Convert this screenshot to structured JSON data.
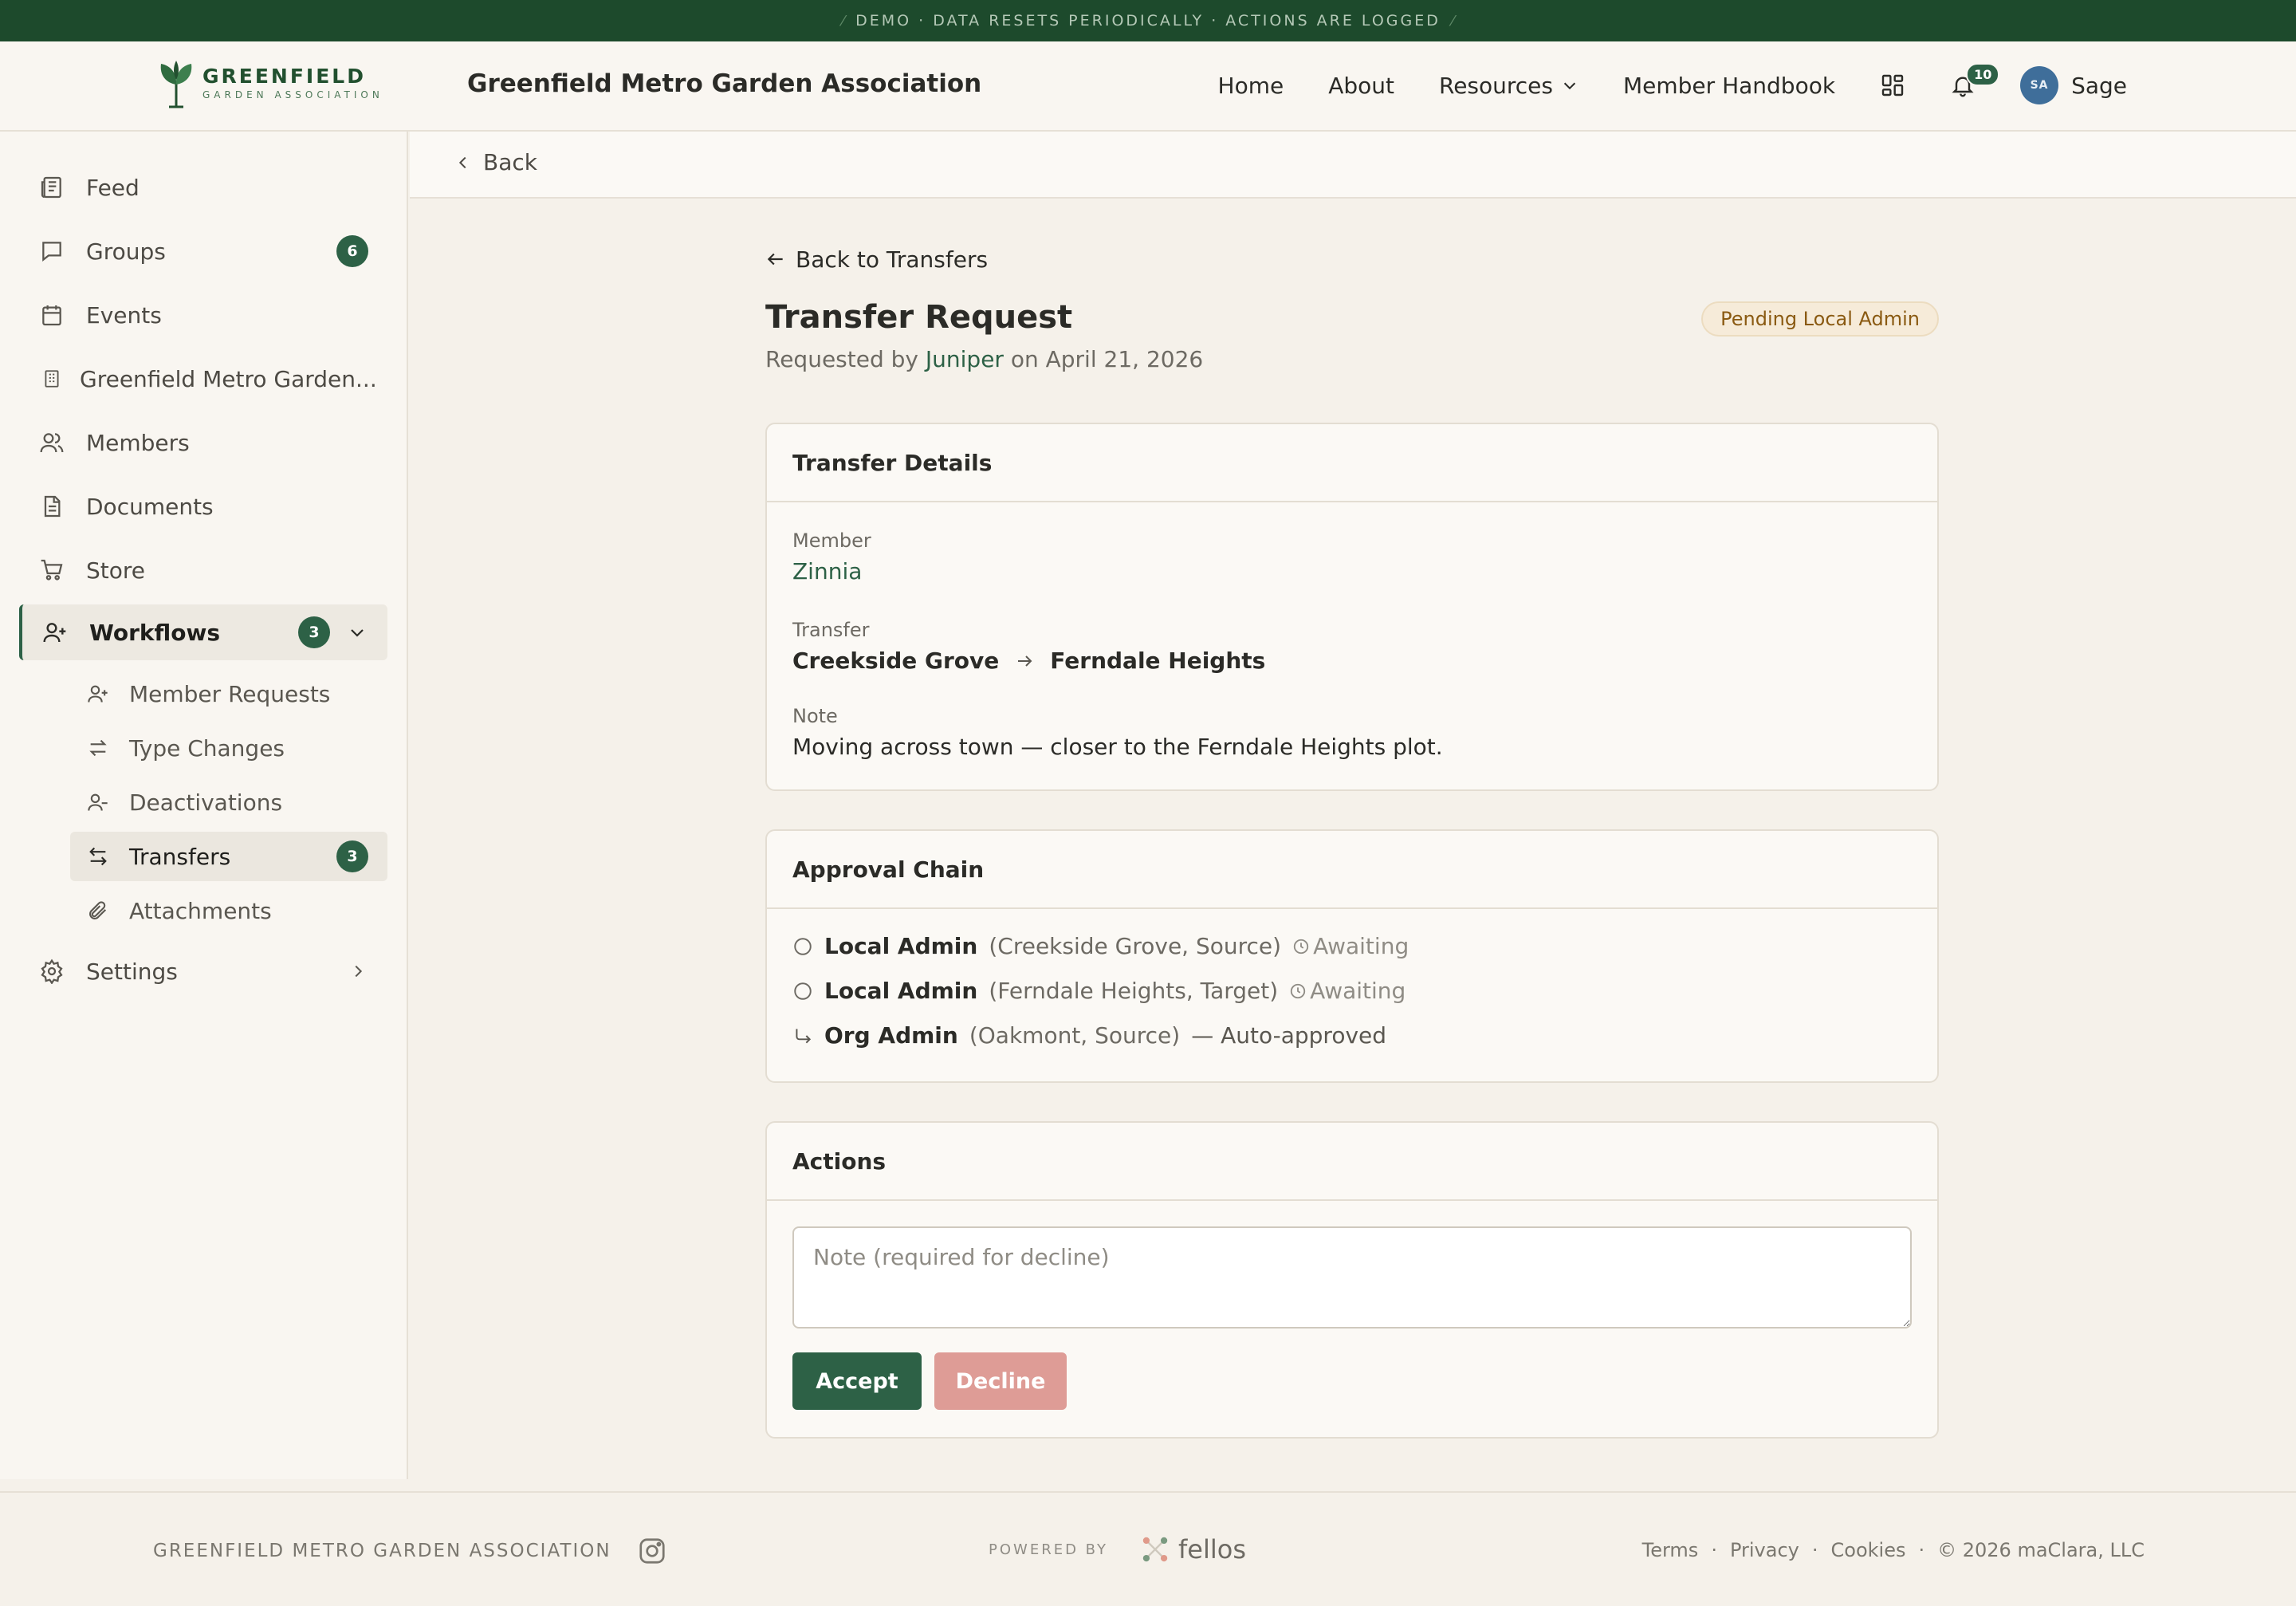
{
  "banner": {
    "text": "DEMO · DATA RESETS PERIODICALLY · ACTIONS ARE LOGGED"
  },
  "brand": {
    "name": "GREENFIELD",
    "sub": "GARDEN ASSOCIATION",
    "color": "#22502f"
  },
  "header": {
    "org_title": "Greenfield Metro Garden Association",
    "nav": {
      "home": "Home",
      "about": "About",
      "resources": "Resources",
      "handbook": "Member Handbook"
    },
    "notifications_count": "10",
    "user": {
      "initials": "SA",
      "name": "Sage"
    }
  },
  "sidebar": {
    "feed": "Feed",
    "groups": {
      "label": "Groups",
      "count": "6"
    },
    "events": "Events",
    "org": "Greenfield Metro Garden...",
    "members": "Members",
    "documents": "Documents",
    "store": "Store",
    "workflows": {
      "label": "Workflows",
      "count": "3"
    },
    "sub": {
      "member_requests": "Member Requests",
      "type_changes": "Type Changes",
      "deactivations": "Deactivations",
      "transfers": {
        "label": "Transfers",
        "count": "3"
      },
      "attachments": "Attachments"
    },
    "settings": "Settings"
  },
  "backbar": {
    "label": "Back"
  },
  "page": {
    "back_link": "Back to Transfers",
    "title": "Transfer Request",
    "status": "Pending Local Admin",
    "requested_prefix": "Requested by",
    "requester": "Juniper",
    "requested_on": "on April 21, 2026"
  },
  "details": {
    "heading": "Transfer Details",
    "member_label": "Member",
    "member": "Zinnia",
    "transfer_label": "Transfer",
    "from": "Creekside Grove",
    "to": "Ferndale Heights",
    "note_label": "Note",
    "note": "Moving across town — closer to the Ferndale Heights plot."
  },
  "approval": {
    "heading": "Approval Chain",
    "steps": [
      {
        "role": "Local Admin",
        "context": "(Creekside Grove, Source)",
        "status": "Awaiting"
      },
      {
        "role": "Local Admin",
        "context": "(Ferndale Heights, Target)",
        "status": "Awaiting"
      },
      {
        "role": "Org Admin",
        "context": "(Oakmont, Source)",
        "status": "— Auto-approved"
      }
    ]
  },
  "actions": {
    "heading": "Actions",
    "note_placeholder": "Note (required for decline)",
    "accept": "Accept",
    "decline": "Decline"
  },
  "footer": {
    "org": "GREENFIELD METRO GARDEN ASSOCIATION",
    "powered_by": "POWERED BY",
    "platform": "fellos",
    "links": {
      "terms": "Terms",
      "privacy": "Privacy",
      "cookies": "Cookies",
      "sep": "·"
    },
    "copyright": "© 2026 maClara, LLC"
  },
  "colors": {
    "accent": "#2d6146",
    "banner_bg": "#1d4a2c",
    "decline": "#de9c96",
    "status_bg": "#f6ebd9"
  }
}
